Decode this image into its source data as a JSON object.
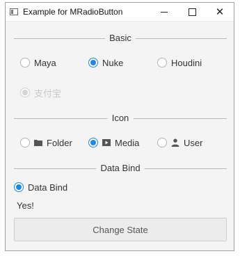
{
  "window": {
    "title": "Example for MRadioButton"
  },
  "sections": {
    "basic": {
      "label": "Basic"
    },
    "icon": {
      "label": "Icon"
    },
    "databind": {
      "label": "Data Bind"
    }
  },
  "basic_options": [
    "Maya",
    "Nuke",
    "Houdini"
  ],
  "basic_selected": "Nuke",
  "disabled_option": {
    "label": "支付宝",
    "checked": true,
    "disabled": true
  },
  "icon_options": [
    {
      "label": "Folder",
      "icon": "folder-icon"
    },
    {
      "label": "Media",
      "icon": "media-play-icon"
    },
    {
      "label": "User",
      "icon": "user-icon"
    }
  ],
  "icon_selected": "Media",
  "databind_radio": {
    "label": "Data Bind",
    "checked": true
  },
  "status_text": "Yes!",
  "button": {
    "label": "Change State"
  },
  "colors": {
    "accent": "#1e88e5",
    "window_bg": "#f4f4f4"
  }
}
